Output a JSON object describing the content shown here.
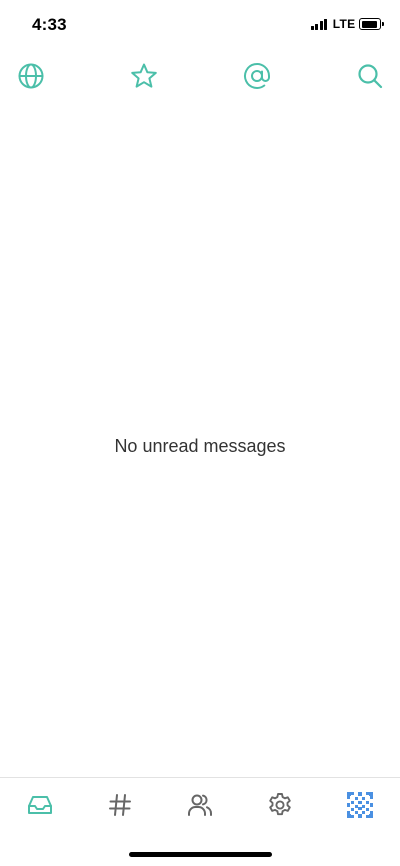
{
  "status_bar": {
    "time": "4:33",
    "network": "LTE"
  },
  "top_nav": {
    "accent_color": "#4bbfa9",
    "items": [
      {
        "icon": "globe-icon"
      },
      {
        "icon": "star-icon"
      },
      {
        "icon": "at-mention-icon"
      },
      {
        "icon": "search-icon"
      }
    ]
  },
  "main": {
    "empty_message": "No unread messages"
  },
  "tab_bar": {
    "active_color": "#4bbfa9",
    "inactive_color": "#666666",
    "avatar_color": "#4a90e2",
    "tabs": [
      {
        "icon": "inbox-icon",
        "active": true
      },
      {
        "icon": "hashtag-icon",
        "active": false
      },
      {
        "icon": "people-icon",
        "active": false
      },
      {
        "icon": "gear-icon",
        "active": false
      },
      {
        "icon": "avatar-icon",
        "active": false
      }
    ]
  }
}
